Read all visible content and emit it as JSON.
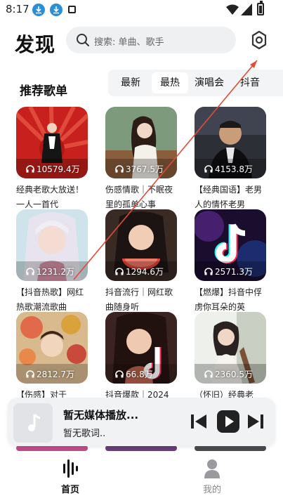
{
  "status_bar": {
    "time": "8:17"
  },
  "header": {
    "title": "发现",
    "search_placeholder": "搜索: 单曲、歌手"
  },
  "section": {
    "title": "推荐歌单",
    "tabs": [
      {
        "label": "最新",
        "active": false
      },
      {
        "label": "最热",
        "active": true
      },
      {
        "label": "演唱会",
        "active": false
      },
      {
        "label": "抖音",
        "active": false
      }
    ]
  },
  "playlists": [
    {
      "plays": "10579.4万",
      "title": "经典老歌大放送！一人一首代"
    },
    {
      "plays": "3767.5万",
      "title": "伤感情歌｜不眠夜里的孤单心事"
    },
    {
      "plays": "4153.8万",
      "title": "【经典国语】老男人的情怀老男"
    },
    {
      "plays": "1231.2万",
      "title": "【抖音热歌】网红热歌潮流歌曲"
    },
    {
      "plays": "1294.6万",
      "title": "抖音流行｜网红歌曲随身听"
    },
    {
      "plays": "2571.3万",
      "title": "【燃爆】抖音中俘虏你耳朵的英"
    },
    {
      "plays": "2812.7万",
      "title": "【伤感】对于"
    },
    {
      "plays": "66.8万",
      "title": "抖音爆款｜2024"
    },
    {
      "plays": "2360.5万",
      "title": "（怀旧）经典老"
    }
  ],
  "player": {
    "title": "暂无媒体播放...",
    "lyric": "暂无歌词.."
  },
  "nav": {
    "home_label": "首页",
    "mine_label": "我的"
  },
  "colors": {
    "accent_blue": "#2a8fd6",
    "overlay_red": "#e04b3a",
    "tab_bg": "#f3f4f6"
  }
}
